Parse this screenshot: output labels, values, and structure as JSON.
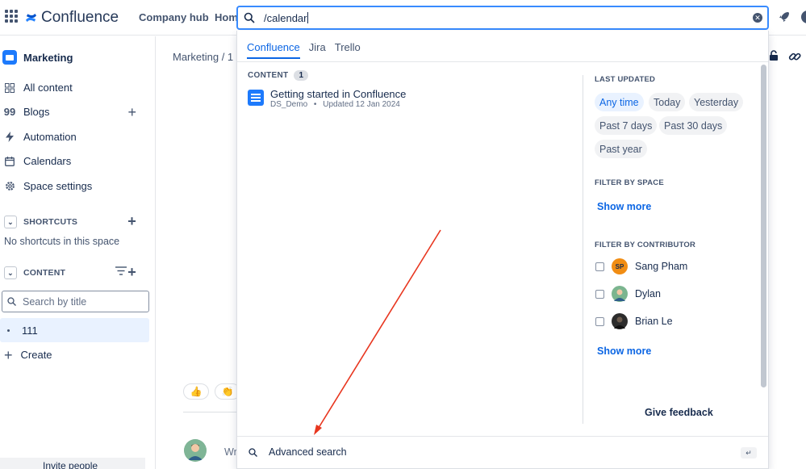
{
  "header": {
    "brand": "Confluence",
    "nav": {
      "company_hub": "Company hub",
      "home": "Hom"
    }
  },
  "search": {
    "value": "/calendar"
  },
  "sidebar": {
    "space_name": "Marketing",
    "items": [
      {
        "label": "All content",
        "icon": "grid-icon"
      },
      {
        "label": "Blogs",
        "icon": "quote-icon"
      },
      {
        "label": "Automation",
        "icon": "lightning-icon"
      },
      {
        "label": "Calendars",
        "icon": "calendar-icon"
      },
      {
        "label": "Space settings",
        "icon": "gear-icon"
      }
    ],
    "shortcuts_label": "SHORTCUTS",
    "no_shortcuts": "No shortcuts in this space",
    "content_label": "CONTENT",
    "search_placeholder": "Search by title",
    "page_item": "111",
    "create": "Create",
    "invite": "Invite people"
  },
  "main": {
    "breadcrumb": "Marketing  /  1",
    "comment_placeholder": "Wr",
    "reactions": [
      "👍",
      "👏"
    ]
  },
  "dropdown": {
    "tabs": [
      "Confluence",
      "Jira",
      "Trello"
    ],
    "content_label": "CONTENT",
    "content_count": "1",
    "result": {
      "title": "Getting started in Confluence",
      "space": "DS_Demo",
      "separator": "•",
      "updated": "Updated 12 Jan 2024"
    },
    "filters": {
      "last_updated_label": "LAST UPDATED",
      "time_chips": [
        "Any time",
        "Today",
        "Yesterday",
        "Past 7 days",
        "Past 30 days",
        "Past year"
      ],
      "space_label": "FILTER BY SPACE",
      "show_more": "Show more",
      "contributor_label": "FILTER BY CONTRIBUTOR",
      "contributors": [
        {
          "name": "Sang Pham",
          "initials": "SP",
          "color": "#f18d13"
        },
        {
          "name": "Dylan",
          "initials": "",
          "color": "#7bb58f"
        },
        {
          "name": "Brian Le",
          "initials": "",
          "color": "#2c2c2c"
        }
      ]
    },
    "feedback": "Give feedback",
    "advanced_search": "Advanced search",
    "enter_key": "↵"
  },
  "colors": {
    "accent": "#0c66e4",
    "annotation_arrow": "#e8361f"
  }
}
